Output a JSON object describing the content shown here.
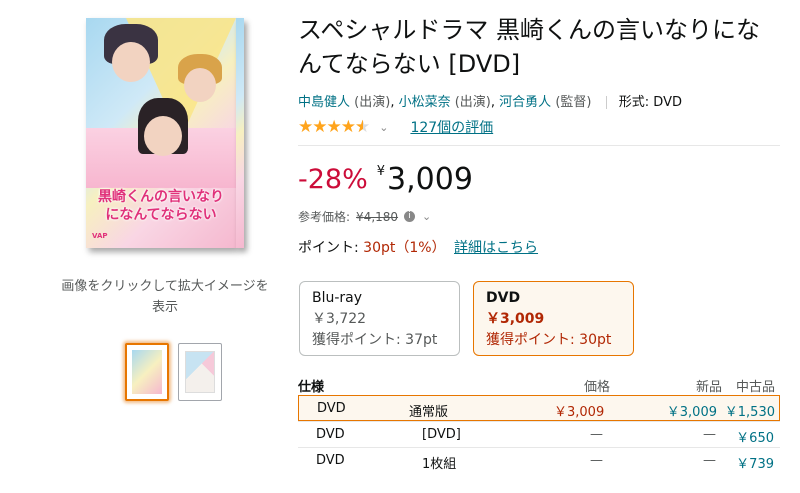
{
  "product": {
    "title": "スペシャルドラマ 黒崎くんの言いなりになんてならない [DVD]",
    "cover_title": "黒崎くんの言いなりになんてならない",
    "contributors": [
      {
        "name": "中島健人",
        "role": "(出演)"
      },
      {
        "name": "小松菜奈",
        "role": "(出演)"
      },
      {
        "name": "河合勇人",
        "role": "(監督)"
      }
    ],
    "format_label": "形式:",
    "format_value": "DVD",
    "rating_stars": 4.5,
    "rating_count": "127個の評価"
  },
  "gallery": {
    "caption": "画像をクリックして拡大イメージを表示",
    "thumbnails": [
      "thumb-front",
      "thumb-back"
    ],
    "selected_index": 0
  },
  "pricing": {
    "discount": "-28%",
    "currency": "¥",
    "price": "3,009",
    "list_price_label": "参考価格:",
    "list_price": "¥4,180",
    "points_label": "ポイント:",
    "points_value": "30pt（1%）",
    "points_link": "詳細はこちら"
  },
  "formats": [
    {
      "name": "Blu-ray",
      "price": "￥3,722",
      "points": "獲得ポイント: 37pt",
      "selected": false
    },
    {
      "name": "DVD",
      "price": "￥3,009",
      "points": "獲得ポイント: 30pt",
      "selected": true
    }
  ],
  "spec_table": {
    "header": {
      "label": "仕様",
      "price": "価格",
      "new": "新品",
      "used": "中古品"
    },
    "rows": [
      {
        "format": "DVD",
        "type": "通常版",
        "price": "￥3,009",
        "new": "￥3,009",
        "used": "￥1,530",
        "selected": true
      },
      {
        "format": "DVD",
        "type": "[DVD]",
        "price": "—",
        "new": "—",
        "used": "￥650",
        "selected": false
      },
      {
        "format": "DVD",
        "type": "1枚組",
        "price": "—",
        "new": "—",
        "used": "￥739",
        "selected": false
      }
    ]
  },
  "colors": {
    "link": "#007185",
    "discount": "#cc0c39",
    "price_red": "#b12704",
    "star": "#ffa41c",
    "selected_border": "#e77600"
  }
}
